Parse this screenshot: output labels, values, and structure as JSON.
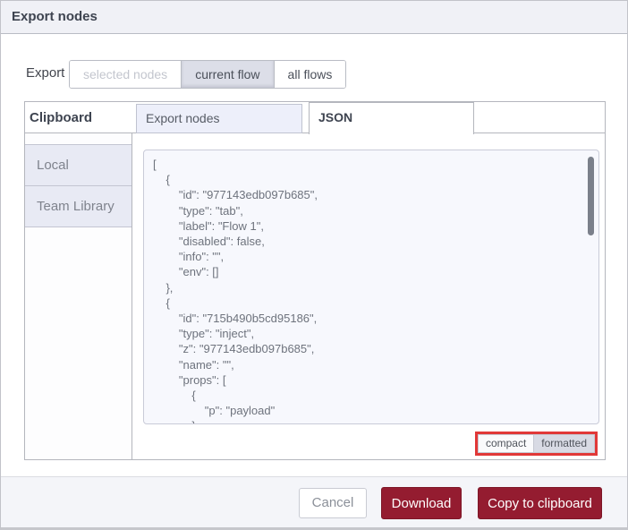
{
  "dialog": {
    "title": "Export nodes",
    "export_row": {
      "label": "Export",
      "options": [
        {
          "label": "selected nodes",
          "state": "disabled"
        },
        {
          "label": "current flow",
          "state": "selected"
        },
        {
          "label": "all flows",
          "state": "normal"
        }
      ]
    },
    "sidebar": {
      "heading": "Clipboard",
      "items": [
        {
          "label": "Local"
        },
        {
          "label": "Team Library"
        }
      ]
    },
    "tabs": [
      {
        "label": "Export nodes",
        "active": false
      },
      {
        "label": "JSON",
        "active": true
      }
    ],
    "code": "[\n    {\n        \"id\": \"977143edb097b685\",\n        \"type\": \"tab\",\n        \"label\": \"Flow 1\",\n        \"disabled\": false,\n        \"info\": \"\",\n        \"env\": []\n    },\n    {\n        \"id\": \"715b490b5cd95186\",\n        \"type\": \"inject\",\n        \"z\": \"977143edb097b685\",\n        \"name\": \"\",\n        \"props\": [\n            {\n                \"p\": \"payload\"\n            },",
    "format_toggle": {
      "compact_label": "compact",
      "formatted_label": "formatted",
      "selected": "formatted",
      "highlight_color": "#e13838"
    },
    "footer": {
      "cancel_label": "Cancel",
      "download_label": "Download",
      "copy_label": "Copy to clipboard"
    },
    "colors": {
      "accent_red": "#941c30",
      "lavender_tab": "#edeffa",
      "lavender_row": "#e8eaf4",
      "code_bg": "#f7f8fd"
    }
  }
}
